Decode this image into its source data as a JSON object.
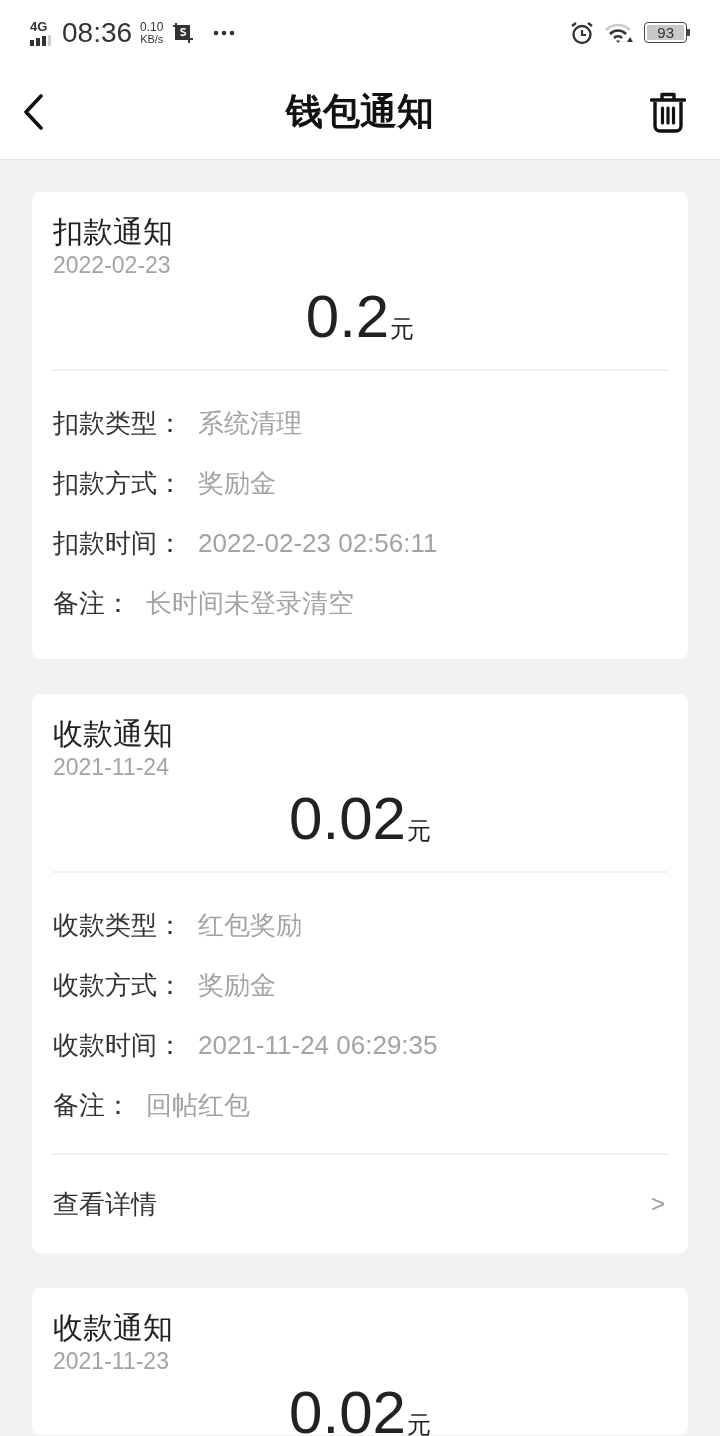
{
  "status_bar": {
    "network_type": "4G",
    "time": "08:36",
    "speed_value": "0.10",
    "speed_unit": "KB/s",
    "battery": "93"
  },
  "header": {
    "title": "钱包通知"
  },
  "notifications": [
    {
      "title": "扣款通知",
      "date": "2022-02-23",
      "amount": "0.2",
      "unit": "元",
      "details": [
        {
          "label": "扣款类型：",
          "value": "系统清理"
        },
        {
          "label": "扣款方式：",
          "value": "奖励金"
        },
        {
          "label": "扣款时间：",
          "value": "2022-02-23 02:56:11"
        },
        {
          "label": "备注：",
          "value": "长时间未登录清空"
        }
      ]
    },
    {
      "title": "收款通知",
      "date": "2021-11-24",
      "amount": "0.02",
      "unit": "元",
      "details": [
        {
          "label": "收款类型：",
          "value": "红包奖励"
        },
        {
          "label": "收款方式：",
          "value": "奖励金"
        },
        {
          "label": "收款时间：",
          "value": "2021-11-24 06:29:35"
        },
        {
          "label": "备注：",
          "value": "回帖红包"
        }
      ],
      "link": {
        "label": "查看详情",
        "arrow": ">"
      }
    },
    {
      "title": "收款通知",
      "date": "2021-11-23",
      "amount": "0.02",
      "unit": "元"
    }
  ]
}
